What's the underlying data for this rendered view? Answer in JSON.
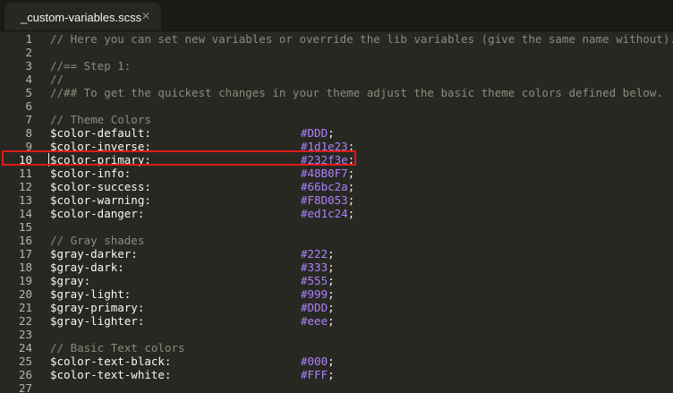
{
  "tab": {
    "title": "_custom-variables.scss",
    "close_glyph": "✕"
  },
  "lines": [
    {
      "n": "1",
      "type": "comment",
      "text": "// Here you can set new variables or override the lib variables (give the same name without)."
    },
    {
      "n": "2",
      "type": "blank",
      "text": ""
    },
    {
      "n": "3",
      "type": "comment",
      "text": "//== Step 1:"
    },
    {
      "n": "4",
      "type": "comment",
      "text": "//"
    },
    {
      "n": "5",
      "type": "comment",
      "text": "//## To get the quickest changes in your theme adjust the basic theme colors defined below."
    },
    {
      "n": "6",
      "type": "blank",
      "text": ""
    },
    {
      "n": "7",
      "type": "comment",
      "text": "// Theme Colors"
    },
    {
      "n": "8",
      "type": "decl",
      "name": "$color-default:",
      "value": "#DDD"
    },
    {
      "n": "9",
      "type": "decl",
      "name": "$color-inverse:",
      "value": "#1d1e23"
    },
    {
      "n": "10",
      "type": "decl",
      "name": "$color-primary:",
      "value": "#232f3e",
      "current": true
    },
    {
      "n": "11",
      "type": "decl",
      "name": "$color-info:",
      "value": "#48B0F7"
    },
    {
      "n": "12",
      "type": "decl",
      "name": "$color-success:",
      "value": "#66bc2a"
    },
    {
      "n": "13",
      "type": "decl",
      "name": "$color-warning:",
      "value": "#F8D053"
    },
    {
      "n": "14",
      "type": "decl",
      "name": "$color-danger:",
      "value": "#ed1c24"
    },
    {
      "n": "15",
      "type": "blank",
      "text": ""
    },
    {
      "n": "16",
      "type": "comment",
      "text": "// Gray shades"
    },
    {
      "n": "17",
      "type": "decl",
      "name": "$gray-darker:",
      "value": "#222"
    },
    {
      "n": "18",
      "type": "decl",
      "name": "$gray-dark:",
      "value": "#333"
    },
    {
      "n": "19",
      "type": "decl",
      "name": "$gray:",
      "value": "#555"
    },
    {
      "n": "20",
      "type": "decl",
      "name": "$gray-light:",
      "value": "#999"
    },
    {
      "n": "21",
      "type": "decl",
      "name": "$gray-primary:",
      "value": "#DDD"
    },
    {
      "n": "22",
      "type": "decl",
      "name": "$gray-lighter:",
      "value": "#eee"
    },
    {
      "n": "23",
      "type": "blank",
      "text": ""
    },
    {
      "n": "24",
      "type": "comment",
      "text": "// Basic Text colors"
    },
    {
      "n": "25",
      "type": "decl",
      "name": "$color-text-black:",
      "value": "#000"
    },
    {
      "n": "26",
      "type": "decl",
      "name": "$color-text-white:",
      "value": "#FFF"
    },
    {
      "n": "27",
      "type": "blank",
      "text": ""
    }
  ],
  "colors": {
    "background": "#272822",
    "tabbar": "#1a1b16",
    "comment": "#8c8b7e",
    "text": "#f8f8f2",
    "value": "#ae81ff",
    "highlight_border": "#e01b1b"
  }
}
